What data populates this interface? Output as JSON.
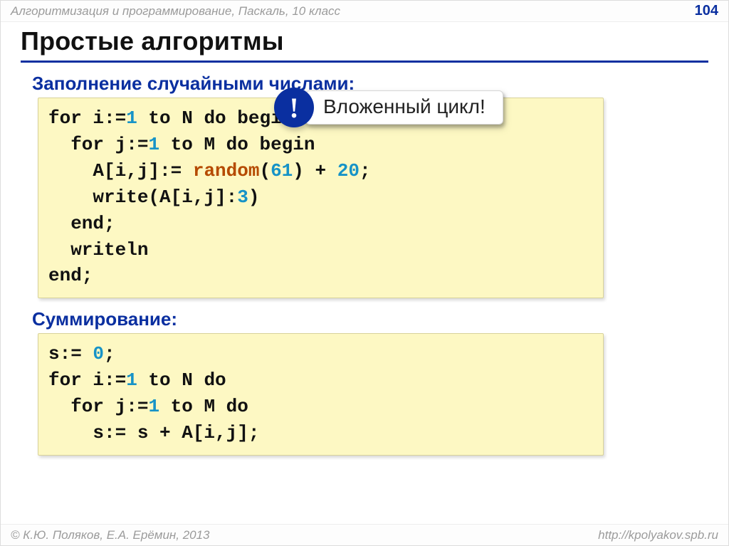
{
  "header": {
    "breadcrumb": "Алгоритмизация и программирование, Паскаль, 10 класс",
    "page_number": "104"
  },
  "title": "Простые алгоритмы",
  "section1": {
    "heading": "Заполнение случайными числами:",
    "code": {
      "l1a": "for i:=",
      "l1b": "1",
      "l1c": " to N do begin",
      "l2a": "  for j:=",
      "l2b": "1",
      "l2c": " to M do begin",
      "l3a": "    A[i,j]:= ",
      "l3b": "random",
      "l3c": "(",
      "l3d": "61",
      "l3e": ") + ",
      "l3f": "20",
      "l3g": ";",
      "l4a": "    write(A[i,j]:",
      "l4b": "3",
      "l4c": ")",
      "l5": "  end;",
      "l6": "  writeln",
      "l7": "end;"
    }
  },
  "callout": {
    "badge": "!",
    "text": "Вложенный цикл!"
  },
  "section2": {
    "heading": "Суммирование:",
    "code": {
      "l1a": "s:= ",
      "l1b": "0",
      "l1c": ";",
      "l2a": "for i:=",
      "l2b": "1",
      "l2c": " to N do",
      "l3a": "  for j:=",
      "l3b": "1",
      "l3c": " to M do",
      "l4": "    s:= s + A[i,j];"
    }
  },
  "footer": {
    "copyright": "© К.Ю. Поляков, Е.А. Ерёмин, 2013",
    "url": "http://kpolyakov.spb.ru"
  }
}
